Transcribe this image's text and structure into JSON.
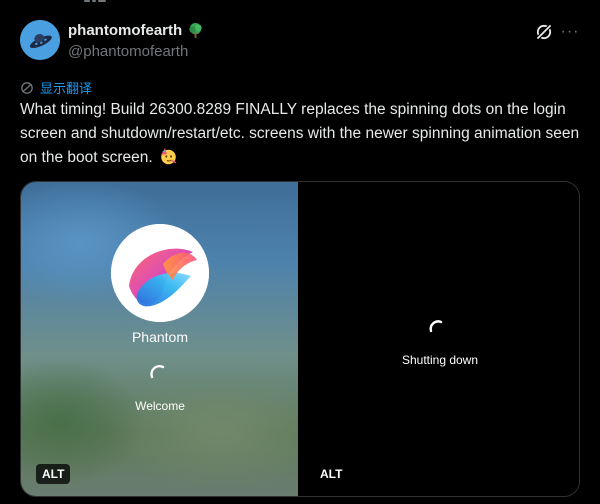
{
  "author": {
    "display_name": "phantomofearth",
    "handle": "@phantomofearth",
    "badge_icon": "tree-icon",
    "avatar_icon": "ufo-avatar-icon",
    "avatar_color": "#4a9fe0"
  },
  "actions": {
    "grok_icon": "grok-icon",
    "more_icon": "more-icon",
    "more_glyph": "···"
  },
  "translate": {
    "label": "显示翻译",
    "icon": "translate-icon",
    "color": "#1d9bf0"
  },
  "tweet": {
    "text": "What timing! Build 26300.8289 FINALLY replaces the spinning dots on the login screen and shutdown/restart/etc. screens with the newer spinning animation seen on the boot screen.",
    "emoji": "partying-face-emoji"
  },
  "media": [
    {
      "user_name": "Phantom",
      "status": "Welcome",
      "alt_label": "ALT"
    },
    {
      "status": "Shutting down",
      "alt_label": "ALT"
    }
  ],
  "colors": {
    "background": "#000000",
    "text_primary": "#e7e9ea",
    "text_secondary": "#71767b",
    "link": "#1d9bf0",
    "border": "#2f3336"
  }
}
